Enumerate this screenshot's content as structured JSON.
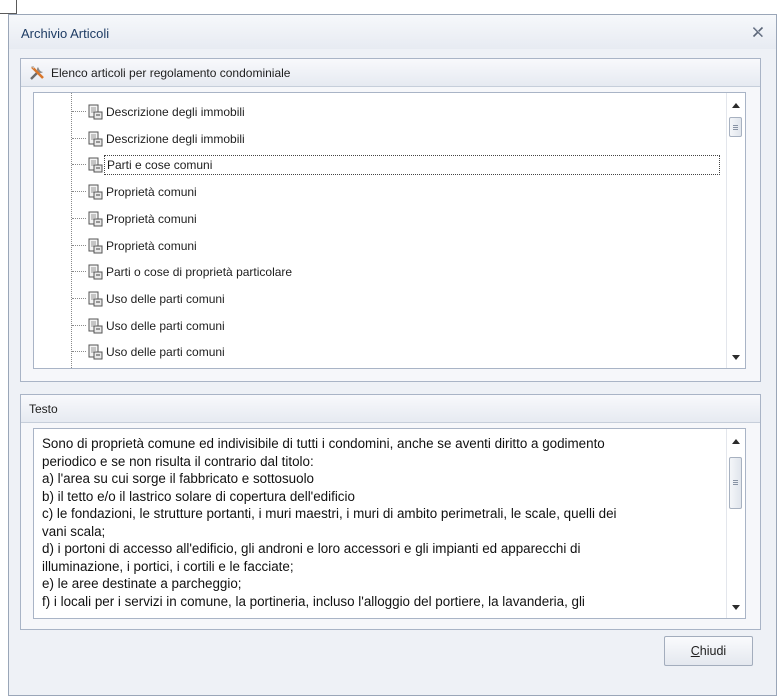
{
  "window": {
    "title": "Archivio Articoli"
  },
  "articles_group": {
    "title": "Elenco articoli per regolamento condominiale",
    "items": [
      {
        "label": "Descrizione degli immobili"
      },
      {
        "label": "Descrizione degli immobili"
      },
      {
        "label": "Parti e cose comuni",
        "selected": true
      },
      {
        "label": "Proprietà comuni"
      },
      {
        "label": "Proprietà comuni"
      },
      {
        "label": "Proprietà comuni"
      },
      {
        "label": "Parti o cose di proprietà particolare"
      },
      {
        "label": "Uso delle parti comuni"
      },
      {
        "label": "Uso delle parti comuni"
      },
      {
        "label": "Uso delle parti comuni"
      }
    ]
  },
  "text_group": {
    "title": "Testo",
    "lines": [
      "Sono di proprietà comune ed indivisibile di tutti i condomini, anche se aventi diritto a godimento",
      "periodico e se non risulta il contrario dal titolo:",
      "a) l'area su cui sorge il fabbricato e sottosuolo",
      "b) il tetto e/o il lastrico solare di copertura dell'edificio",
      "c) le fondazioni, le strutture portanti, i muri maestri, i muri di ambito perimetrali, le scale, quelli dei",
      "vani scala;",
      "d) i portoni di accesso all'edificio, gli androni e loro accessori e gli impianti ed apparecchi di",
      "illuminazione,  i portici, i cortili e le facciate;",
      "e) le aree destinate a parcheggio;",
      "f) i locali per i servizi in comune, la portineria, incluso l'alloggio del portiere, la lavanderia, gli"
    ]
  },
  "buttons": {
    "close_accel": "C",
    "close_rest": "hiudi"
  },
  "icons": {
    "window_close": "close-icon",
    "group": "tools-icon",
    "item": "document-icon"
  }
}
